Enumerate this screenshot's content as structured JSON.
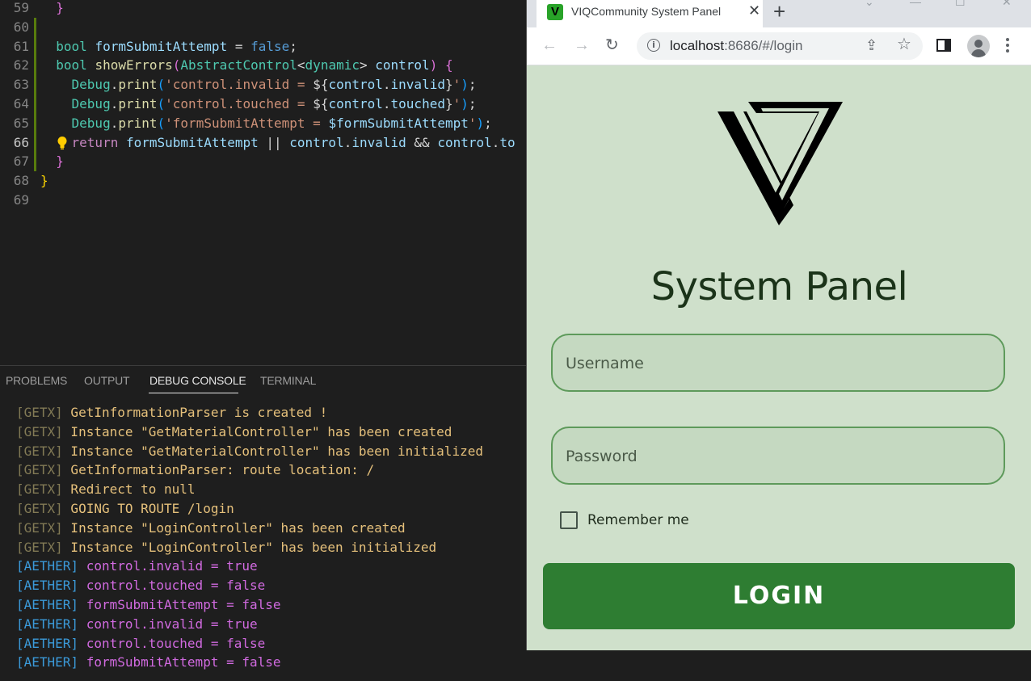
{
  "editor": {
    "lines": [
      {
        "num": "59",
        "tokens": [
          {
            "t": "  ",
            "c": ""
          },
          {
            "t": "}",
            "c": "t-b2"
          }
        ]
      },
      {
        "num": "60",
        "tokens": []
      },
      {
        "num": "61",
        "tokens": [
          {
            "t": "  ",
            "c": ""
          },
          {
            "t": "bool ",
            "c": "t-type"
          },
          {
            "t": "formSubmitAttempt",
            "c": "t-var"
          },
          {
            "t": " = ",
            "c": "t-op"
          },
          {
            "t": "false",
            "c": "t-kw"
          },
          {
            "t": ";",
            "c": "t-op"
          }
        ]
      },
      {
        "num": "62",
        "tokens": [
          {
            "t": "  ",
            "c": ""
          },
          {
            "t": "bool ",
            "c": "t-type"
          },
          {
            "t": "showErrors",
            "c": "t-fn"
          },
          {
            "t": "(",
            "c": "t-b2"
          },
          {
            "t": "AbstractControl",
            "c": "t-type"
          },
          {
            "t": "<",
            "c": "t-op"
          },
          {
            "t": "dynamic",
            "c": "t-type"
          },
          {
            "t": "> ",
            "c": "t-op"
          },
          {
            "t": "control",
            "c": "t-var"
          },
          {
            "t": ") ",
            "c": "t-b2"
          },
          {
            "t": "{",
            "c": "t-b2"
          }
        ]
      },
      {
        "num": "63",
        "tokens": [
          {
            "t": "    ",
            "c": ""
          },
          {
            "t": "Debug",
            "c": "t-type"
          },
          {
            "t": ".",
            "c": "t-op"
          },
          {
            "t": "print",
            "c": "t-fn"
          },
          {
            "t": "(",
            "c": "t-b3"
          },
          {
            "t": "'control.invalid = ",
            "c": "t-str"
          },
          {
            "t": "${",
            "c": "t-op"
          },
          {
            "t": "control",
            "c": "t-var"
          },
          {
            "t": ".",
            "c": "t-op"
          },
          {
            "t": "invalid",
            "c": "t-var"
          },
          {
            "t": "}",
            "c": "t-op"
          },
          {
            "t": "'",
            "c": "t-str"
          },
          {
            "t": ")",
            "c": "t-b3"
          },
          {
            "t": ";",
            "c": "t-op"
          }
        ]
      },
      {
        "num": "64",
        "tokens": [
          {
            "t": "    ",
            "c": ""
          },
          {
            "t": "Debug",
            "c": "t-type"
          },
          {
            "t": ".",
            "c": "t-op"
          },
          {
            "t": "print",
            "c": "t-fn"
          },
          {
            "t": "(",
            "c": "t-b3"
          },
          {
            "t": "'control.touched = ",
            "c": "t-str"
          },
          {
            "t": "${",
            "c": "t-op"
          },
          {
            "t": "control",
            "c": "t-var"
          },
          {
            "t": ".",
            "c": "t-op"
          },
          {
            "t": "touched",
            "c": "t-var"
          },
          {
            "t": "}",
            "c": "t-op"
          },
          {
            "t": "'",
            "c": "t-str"
          },
          {
            "t": ")",
            "c": "t-b3"
          },
          {
            "t": ";",
            "c": "t-op"
          }
        ]
      },
      {
        "num": "65",
        "tokens": [
          {
            "t": "    ",
            "c": ""
          },
          {
            "t": "Debug",
            "c": "t-type"
          },
          {
            "t": ".",
            "c": "t-op"
          },
          {
            "t": "print",
            "c": "t-fn"
          },
          {
            "t": "(",
            "c": "t-b3"
          },
          {
            "t": "'formSubmitAttempt = ",
            "c": "t-str"
          },
          {
            "t": "$formSubmitAttempt",
            "c": "t-var"
          },
          {
            "t": "'",
            "c": "t-str"
          },
          {
            "t": ")",
            "c": "t-b3"
          },
          {
            "t": ";",
            "c": "t-op"
          }
        ]
      },
      {
        "num": "66",
        "tokens": [
          {
            "t": "    ",
            "c": ""
          },
          {
            "t": "return ",
            "c": "t-ctl"
          },
          {
            "t": "formSubmitAttempt",
            "c": "t-var"
          },
          {
            "t": " || ",
            "c": "t-op"
          },
          {
            "t": "control",
            "c": "t-var"
          },
          {
            "t": ".",
            "c": "t-op"
          },
          {
            "t": "invalid",
            "c": "t-var"
          },
          {
            "t": " && ",
            "c": "t-op"
          },
          {
            "t": "control",
            "c": "t-var"
          },
          {
            "t": ".",
            "c": "t-op"
          },
          {
            "t": "to",
            "c": "t-var"
          }
        ]
      },
      {
        "num": "67",
        "tokens": [
          {
            "t": "  ",
            "c": ""
          },
          {
            "t": "}",
            "c": "t-b2"
          }
        ]
      },
      {
        "num": "68",
        "tokens": [
          {
            "t": "}",
            "c": "t-b1"
          }
        ]
      },
      {
        "num": "69",
        "tokens": []
      }
    ]
  },
  "panel": {
    "tabs": [
      "PROBLEMS",
      "OUTPUT",
      "DEBUG CONSOLE",
      "TERMINAL"
    ],
    "active_tab": "DEBUG CONSOLE",
    "logs": [
      {
        "tag": "[GETX]",
        "msg": " GetInformationParser is created !",
        "kind": "getx"
      },
      {
        "tag": "[GETX]",
        "msg": " Instance \"GetMaterialController\" has been created",
        "kind": "getx"
      },
      {
        "tag": "[GETX]",
        "msg": " Instance \"GetMaterialController\" has been initialized",
        "kind": "getx"
      },
      {
        "tag": "[GETX]",
        "msg": " GetInformationParser: route location: /",
        "kind": "getx"
      },
      {
        "tag": "[GETX]",
        "msg": " Redirect to null",
        "kind": "getx"
      },
      {
        "tag": "[GETX]",
        "msg": " GOING TO ROUTE /login",
        "kind": "getx"
      },
      {
        "tag": "[GETX]",
        "msg": " Instance \"LoginController\" has been created",
        "kind": "getx"
      },
      {
        "tag": "[GETX]",
        "msg": " Instance \"LoginController\" has been initialized",
        "kind": "getx"
      },
      {
        "tag": "[AETHER]",
        "msg": " control.invalid = true",
        "kind": "aether"
      },
      {
        "tag": "[AETHER]",
        "msg": " control.touched = false",
        "kind": "aether"
      },
      {
        "tag": "[AETHER]",
        "msg": " formSubmitAttempt = false",
        "kind": "aether"
      },
      {
        "tag": "[AETHER]",
        "msg": " control.invalid = true",
        "kind": "aether"
      },
      {
        "tag": "[AETHER]",
        "msg": " control.touched = false",
        "kind": "aether"
      },
      {
        "tag": "[AETHER]",
        "msg": " formSubmitAttempt = false",
        "kind": "aether"
      }
    ]
  },
  "browser": {
    "tab_title": "VIQCommunity System Panel",
    "favicon_letter": "V",
    "url_host": "localhost",
    "url_rest": ":8686/#/login",
    "icons": [
      "back-icon",
      "forward-icon",
      "reload-icon",
      "info-icon",
      "share-icon",
      "star-icon",
      "side-panel-icon",
      "profile-icon",
      "menu-icon"
    ]
  },
  "page": {
    "title": "System Panel",
    "username_placeholder": "Username",
    "password_placeholder": "Password",
    "remember_label": "Remember me",
    "login_label": "LOGIN",
    "accent": "#2e7d32",
    "background": "#cfe0cb"
  }
}
